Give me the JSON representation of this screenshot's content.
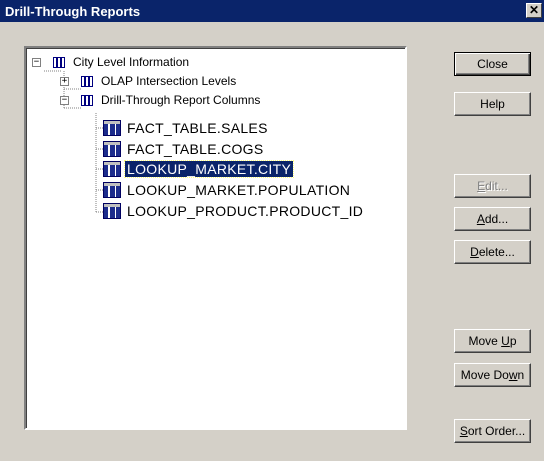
{
  "window": {
    "title": "Drill-Through Reports",
    "close_glyph": "✕"
  },
  "tree": {
    "root": {
      "label": "City Level Information",
      "expander": "−"
    },
    "olap": {
      "label": "OLAP Intersection Levels",
      "expander": "+"
    },
    "drill": {
      "label": "Drill-Through Report Columns",
      "expander": "−"
    },
    "columns": [
      {
        "label": "FACT_TABLE.SALES",
        "selected": false
      },
      {
        "label": "FACT_TABLE.COGS",
        "selected": false
      },
      {
        "label": "LOOKUP_MARKET.CITY",
        "selected": true
      },
      {
        "label": "LOOKUP_MARKET.POPULATION",
        "selected": false
      },
      {
        "label": "LOOKUP_PRODUCT.PRODUCT_ID",
        "selected": false
      }
    ]
  },
  "buttons": {
    "close": "Close",
    "help": "Help",
    "edit": {
      "pre": "",
      "key": "E",
      "post": "dit...",
      "enabled": false
    },
    "add": {
      "pre": "",
      "key": "A",
      "post": "dd...",
      "enabled": true
    },
    "delete": {
      "pre": "",
      "key": "D",
      "post": "elete...",
      "enabled": true
    },
    "move_up": {
      "pre": "Move ",
      "key": "U",
      "post": "p",
      "enabled": true
    },
    "move_down": {
      "pre": "Move Do",
      "key": "w",
      "post": "n",
      "enabled": true
    },
    "sort_order": {
      "pre": "",
      "key": "S",
      "post": "ort Order...",
      "enabled": true
    }
  }
}
